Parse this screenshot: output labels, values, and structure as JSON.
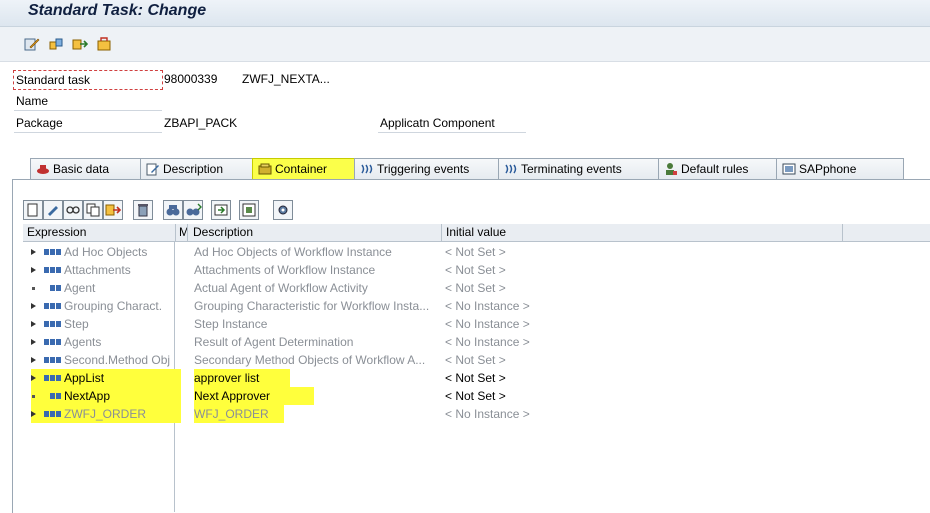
{
  "window": {
    "title": "Standard Task: Change"
  },
  "toolbar": {
    "icons": [
      "display-change-icon",
      "other-object-icon",
      "where-used-icon",
      "transport-icon"
    ]
  },
  "header": {
    "standard_task_label": "Standard task",
    "standard_task_id": "98000339",
    "standard_task_abbr": "ZWFJ_NEXTA...",
    "name_label": "Name",
    "package_label": "Package",
    "package_value": "ZBAPI_PACK",
    "appl_component_label": "Applicatn Component"
  },
  "tabs": [
    {
      "label": "Basic data",
      "icon": "hat-icon"
    },
    {
      "label": "Description",
      "icon": "edit-icon"
    },
    {
      "label": "Container",
      "icon": "container-icon",
      "active": true
    },
    {
      "label": "Triggering events",
      "icon": "event-icon"
    },
    {
      "label": "Terminating events",
      "icon": "event-icon"
    },
    {
      "label": "Default rules",
      "icon": "user-rule-icon"
    },
    {
      "label": "SAPphone",
      "icon": "phone-icon"
    }
  ],
  "grid": {
    "columns": {
      "expression": "Expression",
      "m": "M",
      "description": "Description",
      "initial_value": "Initial value"
    },
    "rows": [
      {
        "name": "Ad Hoc Objects",
        "description": "Ad Hoc Objects of Workflow Instance",
        "initial": "< Not Set >"
      },
      {
        "name": "Attachments",
        "description": "Attachments of Workflow Instance",
        "initial": "< Not Set >"
      },
      {
        "name": "Agent",
        "description": "Actual Agent of Workflow Activity",
        "initial": "< Not Set >"
      },
      {
        "name": "Grouping Charact.",
        "description": "Grouping Characteristic for Workflow Insta...",
        "initial": "< No Instance >"
      },
      {
        "name": "Step",
        "description": "Step Instance",
        "initial": "< No Instance >"
      },
      {
        "name": "Agents",
        "description": "Result of Agent Determination",
        "initial": "< No Instance >"
      },
      {
        "name": "Second.Method Obj",
        "description": "Secondary Method Objects of Workflow A...",
        "initial": "< Not Set >"
      },
      {
        "name": "AppList",
        "description": "approver list",
        "initial": "< Not Set >"
      },
      {
        "name": "NextApp",
        "description": "Next Approver",
        "initial": "< Not Set >"
      },
      {
        "name": "ZWFJ_ORDER",
        "description": "WFJ_ORDER",
        "initial": "< No Instance >"
      }
    ]
  },
  "colors": {
    "highlight": "#ffff3c",
    "title": "#102040",
    "system_grey": "#8a8f96"
  }
}
